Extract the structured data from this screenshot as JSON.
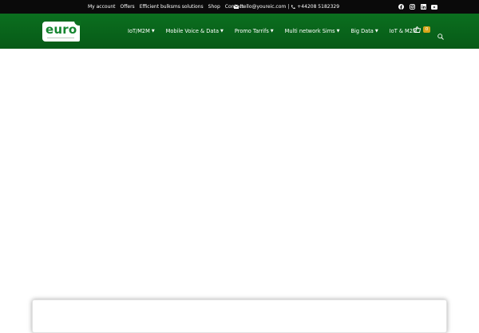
{
  "topbar": {
    "links": [
      "My account",
      "Offers",
      "Efficient bulksms solutions",
      "Shop",
      "Contact"
    ],
    "email": "hello@youreic.com",
    "separator": "|",
    "phone": "+44208 5182329",
    "social_icons": [
      "facebook-icon",
      "instagram-icon",
      "linkedin-icon",
      "youtube-icon"
    ]
  },
  "header": {
    "logo_text": "euro",
    "nav": [
      {
        "label": "IoT/M2M",
        "dropdown": true
      },
      {
        "label": "Mobile Voice & Data",
        "dropdown": true
      },
      {
        "label": "Promo Tarrifs",
        "dropdown": true
      },
      {
        "label": "Multi network Sims",
        "dropdown": true
      },
      {
        "label": "Big Data",
        "dropdown": true
      },
      {
        "label": "IoT & M2M",
        "dropdown": false
      }
    ],
    "cart_count": "0"
  },
  "colors": {
    "topbar_bg": "#0a0a0a",
    "header_green": "#0b6f1f",
    "logo_green": "#14852f",
    "badge_gold": "#d6a51a"
  }
}
